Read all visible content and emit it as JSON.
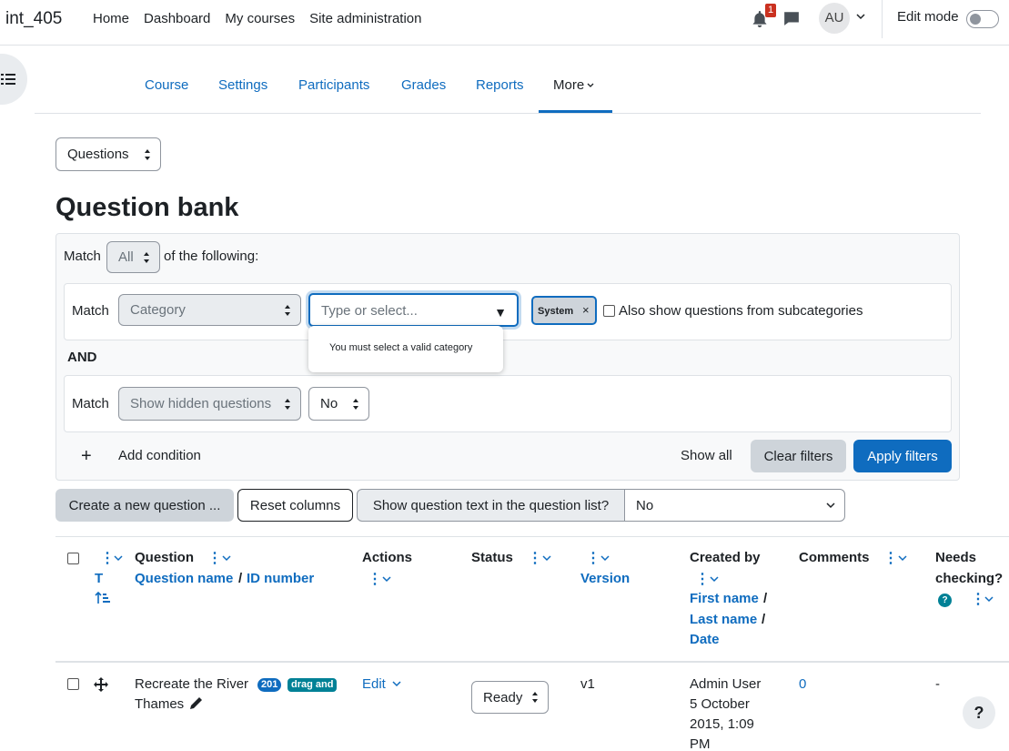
{
  "navbar": {
    "site_name": "int_405",
    "links": [
      "Home",
      "Dashboard",
      "My courses",
      "Site administration"
    ],
    "notification_count": "1",
    "avatar_initials": "AU",
    "edit_mode_label": "Edit mode"
  },
  "secondary_nav": {
    "items": [
      "Course",
      "Settings",
      "Participants",
      "Grades",
      "Reports"
    ],
    "more_label": "More",
    "active": "More"
  },
  "page_select": {
    "value": "Questions"
  },
  "page_title": "Question bank",
  "filters": {
    "match_label": "Match",
    "match_value": "All",
    "of_following": "of the following:",
    "condition1": {
      "match_label": "Match",
      "type_value": "Category",
      "placeholder": "Type or select...",
      "error_tooltip": "You must select a valid category",
      "chip_label": "System",
      "chip_remove": "×",
      "subcategories_label": "Also show questions from subcategories"
    },
    "join_label": "AND",
    "condition2": {
      "match_label": "Match",
      "type_value": "Show hidden questions",
      "value": "No"
    },
    "add_condition_icon": "+",
    "add_condition_label": "Add condition",
    "show_all": "Show all",
    "clear_filters": "Clear filters",
    "apply_filters": "Apply filters"
  },
  "toolbar": {
    "create_question": "Create a new question ...",
    "reset_columns": "Reset columns",
    "show_text_label": "Show question text in the question list?",
    "show_text_value": "No"
  },
  "table": {
    "headers": {
      "type_short": "T",
      "question": "Question",
      "question_name": "Question name",
      "sep": "/",
      "id_number": "ID number",
      "actions": "Actions",
      "status": "Status",
      "version": "Version",
      "created_by": "Created by",
      "first_name": "First name",
      "last_name": "Last name",
      "date": "Date",
      "comments": "Comments",
      "needs_checking_1": "Needs",
      "needs_checking_2": "checking?",
      "help": "?"
    },
    "rows": [
      {
        "name_line1": "Recreate the River",
        "name_line2": "Thames",
        "id_badge": "201",
        "type_badge": "drag and",
        "action": "Edit",
        "status": "Ready",
        "version": "v1",
        "created_by_name": "Admin User",
        "created_date_1": "5 October",
        "created_date_2": "2015, 1:09",
        "created_date_3": "PM",
        "comments": "0",
        "needs_checking": "-"
      }
    ]
  },
  "help_button": "?",
  "colors": {
    "brand": "#0f6cbf",
    "badge_blue": "#0f6cbf",
    "badge_teal": "#008196",
    "danger": "#ca3120"
  }
}
